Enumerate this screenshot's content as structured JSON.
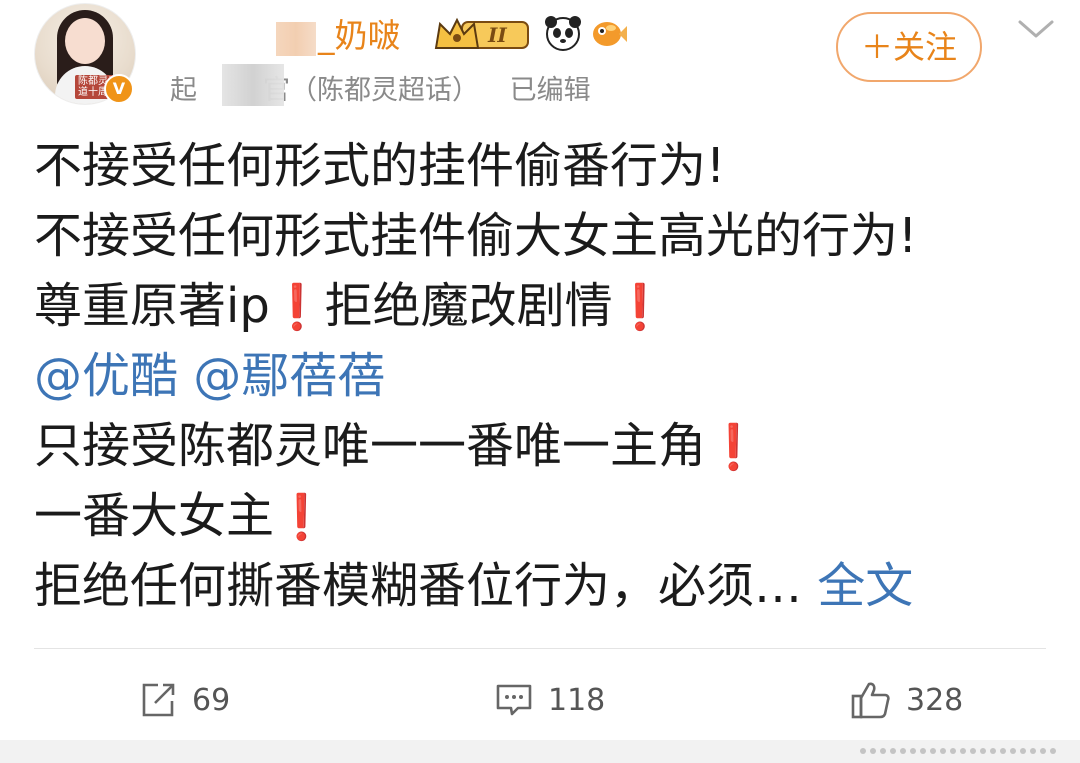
{
  "post": {
    "author": {
      "name": "_奶啵",
      "avatar_caption": "陈都灵出道十周年",
      "source": "超话主持官（陈都灵超话）",
      "source_visible": "起",
      "source_suffix": "官（陈都灵超话）",
      "edited": "已编辑"
    },
    "follow_label": "＋关注",
    "badge_text": "II",
    "lines": [
      {
        "text": "不接受任何形式的挂件偷番行为!"
      },
      {
        "text": "不接受任何形式挂件偷大女主高光的行为!"
      },
      {
        "text": "尊重原著ip",
        "mark": "❗",
        "text2": "拒绝魔改剧情",
        "mark2": "❗"
      },
      {
        "mention1": "@优酷",
        "mention2": "@鄢蓓蓓"
      },
      {
        "text": "只接受陈都灵唯一一番唯一主角",
        "mark": "❗"
      },
      {
        "text": "一番大女主",
        "mark": "❗"
      },
      {
        "text": "拒绝任何撕番模糊番位行为，必须…",
        "more": "全文"
      }
    ],
    "actions": {
      "repost_count": "69",
      "comment_count": "118",
      "like_count": "328"
    }
  },
  "icons": {
    "verified": "verified-v-icon",
    "crown_badge": "crown-level-badge-icon",
    "panda": "panda-emoji-icon",
    "fish": "fish-emoji-icon",
    "chevron": "chevron-down-icon",
    "repost": "repost-icon",
    "comment": "comment-icon",
    "like": "like-thumb-icon"
  },
  "colors": {
    "name": "#e8841a",
    "follow_border": "#f1a76c",
    "mention": "#3d75b6",
    "exclaim": "#e0242a",
    "meta": "#8a8a8a"
  }
}
